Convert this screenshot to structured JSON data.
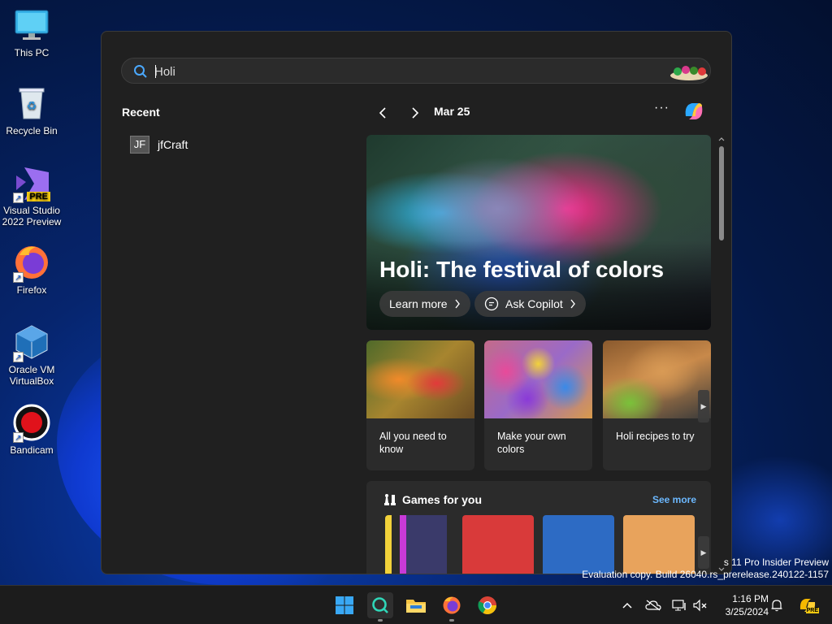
{
  "desktop": {
    "icons": [
      {
        "label": "This PC"
      },
      {
        "label": "Recycle Bin"
      },
      {
        "label": "Visual Studio 2022 Preview",
        "badge": "PRE"
      },
      {
        "label": "Firefox"
      },
      {
        "label": "Oracle VM VirtualBox"
      },
      {
        "label": "Bandicam"
      }
    ]
  },
  "search": {
    "query": "Holi",
    "recent_title": "Recent",
    "recent_items": [
      {
        "initials": "JF",
        "label": "jfCraft"
      }
    ],
    "date": "Mar 25",
    "more": "···",
    "hero": {
      "title": "Holi: The festival of colors",
      "learn_more": "Learn more",
      "ask_copilot": "Ask Copilot"
    },
    "cards": [
      {
        "caption": "All you need to know"
      },
      {
        "caption": "Make your own colors"
      },
      {
        "caption": "Holi recipes to try"
      }
    ],
    "games": {
      "title": "Games for you",
      "see_more": "See more"
    }
  },
  "watermark": {
    "line1": "s 11 Pro Insider Preview",
    "line2": "Evaluation copy. Build 26040.rs_prerelease.240122-1157"
  },
  "taskbar": {
    "time": "1:16 PM",
    "date": "3/25/2024",
    "copilot_badge": "PRE"
  },
  "colors": {
    "accent_link": "#6cb8ff",
    "panel_bg": "#202020",
    "card_bg": "#2b2b2b",
    "game_tile_red": "#d93a3a",
    "game_tile_blue": "#2d6bc4",
    "game_tile_orange": "#e8a35c"
  }
}
